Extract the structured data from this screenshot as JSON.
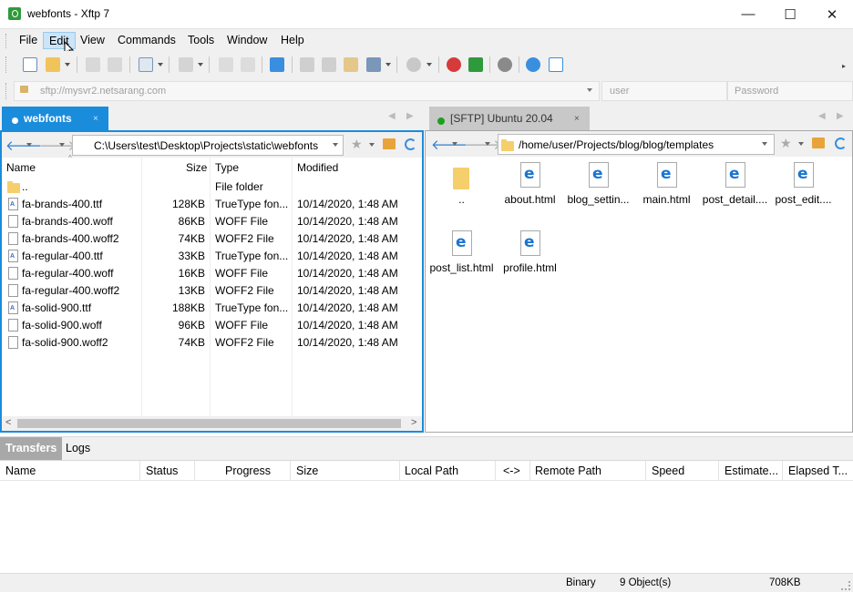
{
  "window": {
    "title": "webfonts - Xftp 7",
    "minimize": "—",
    "maximize": "☐",
    "close": "✕"
  },
  "menu": [
    "File",
    "Edit",
    "View",
    "Commands",
    "Tools",
    "Window",
    "Help"
  ],
  "address": {
    "host_placeholder": "sftp://mysvr2.netsarang.com",
    "user_placeholder": "user",
    "password_placeholder": "Password"
  },
  "tabs": {
    "local": "webfonts",
    "remote": "[SFTP] Ubuntu 20.04",
    "close_glyph": "×"
  },
  "local": {
    "path": "C:\\Users\\test\\Desktop\\Projects\\static\\webfonts",
    "columns": {
      "name": "Name",
      "size": "Size",
      "type": "Type",
      "modified": "Modified"
    },
    "rows": [
      {
        "name": "..",
        "size": "",
        "type": "File folder",
        "modified": "",
        "icon": "folder"
      },
      {
        "name": "fa-brands-400.ttf",
        "size": "128KB",
        "type": "TrueType fon...",
        "modified": "10/14/2020, 1:48 AM",
        "icon": "ttf"
      },
      {
        "name": "fa-brands-400.woff",
        "size": "86KB",
        "type": "WOFF File",
        "modified": "10/14/2020, 1:48 AM",
        "icon": "file"
      },
      {
        "name": "fa-brands-400.woff2",
        "size": "74KB",
        "type": "WOFF2 File",
        "modified": "10/14/2020, 1:48 AM",
        "icon": "file"
      },
      {
        "name": "fa-regular-400.ttf",
        "size": "33KB",
        "type": "TrueType fon...",
        "modified": "10/14/2020, 1:48 AM",
        "icon": "ttf"
      },
      {
        "name": "fa-regular-400.woff",
        "size": "16KB",
        "type": "WOFF File",
        "modified": "10/14/2020, 1:48 AM",
        "icon": "file"
      },
      {
        "name": "fa-regular-400.woff2",
        "size": "13KB",
        "type": "WOFF2 File",
        "modified": "10/14/2020, 1:48 AM",
        "icon": "file"
      },
      {
        "name": "fa-solid-900.ttf",
        "size": "188KB",
        "type": "TrueType fon...",
        "modified": "10/14/2020, 1:48 AM",
        "icon": "ttf"
      },
      {
        "name": "fa-solid-900.woff",
        "size": "96KB",
        "type": "WOFF File",
        "modified": "10/14/2020, 1:48 AM",
        "icon": "file"
      },
      {
        "name": "fa-solid-900.woff2",
        "size": "74KB",
        "type": "WOFF2 File",
        "modified": "10/14/2020, 1:48 AM",
        "icon": "file"
      }
    ]
  },
  "remote": {
    "path": "/home/user/Projects/blog/blog/templates",
    "items": [
      {
        "name": "..",
        "icon": "folder"
      },
      {
        "name": "about.html",
        "icon": "html"
      },
      {
        "name": "blog_settin...",
        "icon": "html"
      },
      {
        "name": "main.html",
        "icon": "html"
      },
      {
        "name": "post_detail....",
        "icon": "html"
      },
      {
        "name": "post_edit....",
        "icon": "html"
      },
      {
        "name": "post_list.html",
        "icon": "html"
      },
      {
        "name": "profile.html",
        "icon": "html"
      }
    ]
  },
  "bottom_tabs": [
    "Transfers",
    "Logs"
  ],
  "transfer_columns": [
    "Name",
    "Status",
    "Progress",
    "Size",
    "Local Path",
    "<->",
    "Remote Path",
    "Speed",
    "Estimate...",
    "Elapsed T..."
  ],
  "status": {
    "mode": "Binary",
    "objects": "9 Object(s)",
    "size": "708KB"
  },
  "colors": {
    "accent": "#1a8cdc",
    "remote_connected": "#1ea01e"
  }
}
